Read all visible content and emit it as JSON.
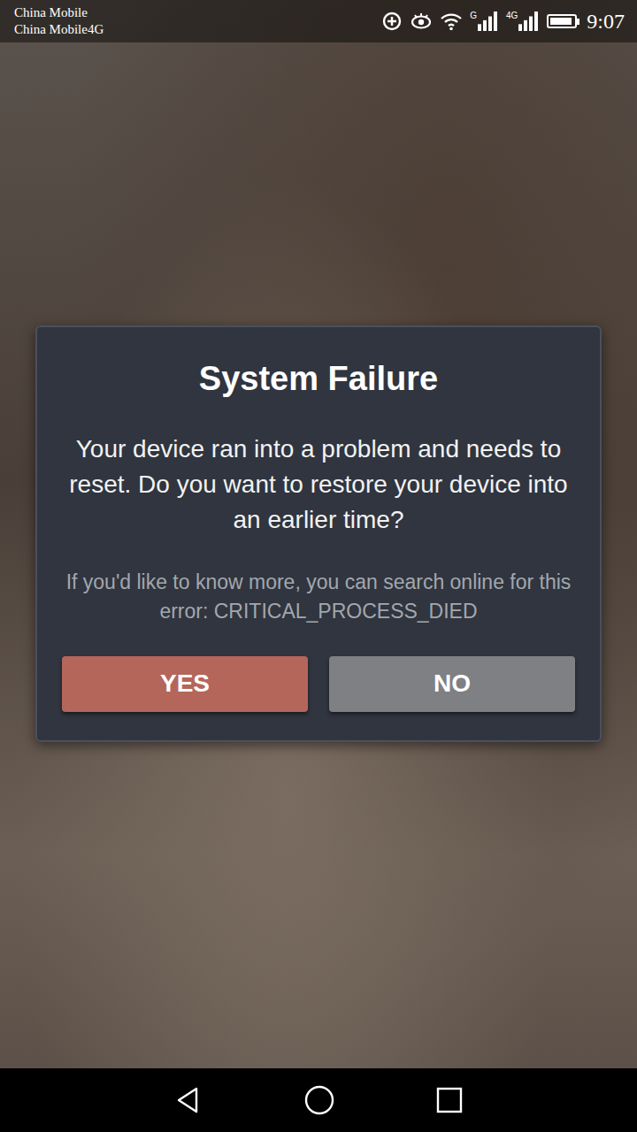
{
  "status_bar": {
    "carriers": [
      "China Mobile",
      "China Mobile4G"
    ],
    "signals": [
      {
        "label": "G",
        "level": 1
      },
      {
        "label": "4G",
        "level": 1
      }
    ],
    "battery": {
      "level": 0.9
    },
    "time": "9:07"
  },
  "dialog": {
    "title": "System Failure",
    "message": "Your device ran into a problem and needs to reset. Do you want to restore your device into an earlier time?",
    "hint": "If you'd like to know more, you can search online for this error: CRITICAL_PROCESS_DIED",
    "buttons": [
      {
        "label": "YES",
        "color": "#b5665b"
      },
      {
        "label": "NO",
        "color": "#7e8084"
      }
    ]
  }
}
